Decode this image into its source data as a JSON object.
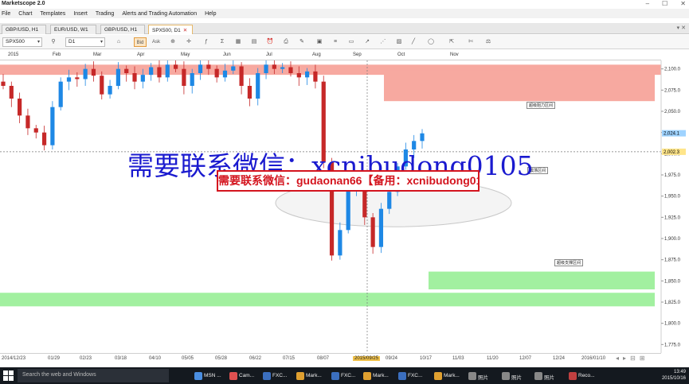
{
  "app": {
    "title": "Marketscope 2.0"
  },
  "menu": [
    "File",
    "Chart",
    "Templates",
    "Insert",
    "Trading",
    "Alerts and Trading Automation",
    "Help"
  ],
  "tabs": [
    {
      "label": "GBP/USD, H1",
      "active": false
    },
    {
      "label": "EUR/USD, W1",
      "active": false
    },
    {
      "label": "GBP/USD, H1",
      "active": false
    },
    {
      "label": "SPX500, D1",
      "active": true
    }
  ],
  "toolbar": {
    "instrument": "SPX500",
    "timeframe": "D1",
    "bid_label": "Bid",
    "ask_label": "Ask"
  },
  "timeline": {
    "months": [
      "2015",
      "Feb",
      "Mar",
      "Apr",
      "May",
      "Jun",
      "Jul",
      "Aug",
      "Sep",
      "Oct",
      "Nov"
    ],
    "dates": [
      "2014/12/23",
      "01/29",
      "02/23",
      "03/18",
      "04/10",
      "05/05",
      "05/28",
      "06/22",
      "07/15",
      "08/07",
      "2015/09/25",
      "09/24",
      "10/17",
      "11/03",
      "11/20",
      "12/07",
      "12/24",
      "2016/01/10"
    ]
  },
  "price_axis": {
    "ticks": [
      "2,100.0",
      "2,075.0",
      "2,050.0",
      "2,025.0",
      "2,000.0",
      "1,975.0",
      "1,950.0",
      "1,925.0",
      "1,900.0",
      "1,875.0",
      "1,850.0",
      "1,825.0",
      "1,800.0",
      "1,775.0"
    ],
    "last_price": "2,024.1",
    "crosshair_price": "2,002.3"
  },
  "overlays": {
    "big_text": "需要联系微信：xcnibudong0105",
    "red_box_text": "需要联系微信：gudaonan66【备用：xcnibudong0105】"
  },
  "zones": [
    {
      "label": "超级阻力区间",
      "type": "resistance"
    },
    {
      "label": "震荡区间",
      "type": "range"
    },
    {
      "label": "超级支撑区间",
      "type": "support"
    }
  ],
  "colors": {
    "resistance": "#f7a9a0",
    "support": "#a2f0a0",
    "bull": "#1e88e5",
    "bear": "#c62828",
    "last_price_bg": "#9fd3ff",
    "cross_price_bg": "#ffe58a"
  },
  "taskbar": {
    "search_placeholder": "Search the web and Windows",
    "items": [
      "MSN ...",
      "Cam...",
      "FXC...",
      "Mark...",
      "FXC...",
      "FXC...",
      "Mark...",
      "FXC...",
      "FXC...",
      "Mark...",
      "照片",
      "照片",
      "照片",
      "FXC...",
      "Reco..."
    ],
    "time": "13:49",
    "date": "2015/10/16"
  },
  "chart_data": {
    "type": "candlestick",
    "instrument": "SPX500",
    "timeframe": "D1",
    "ylim": [
      1765,
      2110
    ],
    "grid": false,
    "close_path": [
      2080,
      2065,
      2045,
      2030,
      2025,
      2010,
      2055,
      2085,
      2090,
      2088,
      2100,
      2092,
      2070,
      2080,
      2100,
      2095,
      2085,
      2093,
      2102,
      2090,
      2105,
      2100,
      2080,
      2095,
      2105,
      2100,
      2090,
      2098,
      2103,
      2080,
      2065,
      2095,
      2105,
      2100,
      2102,
      2095,
      2090,
      2097,
      2085,
      1990,
      1880,
      1910,
      1960,
      1970,
      1925,
      1890,
      1935,
      1955,
      1985,
      2005,
      2015,
      2024
    ],
    "last_price": 2024.1,
    "crosshair_price": 2002.3
  }
}
